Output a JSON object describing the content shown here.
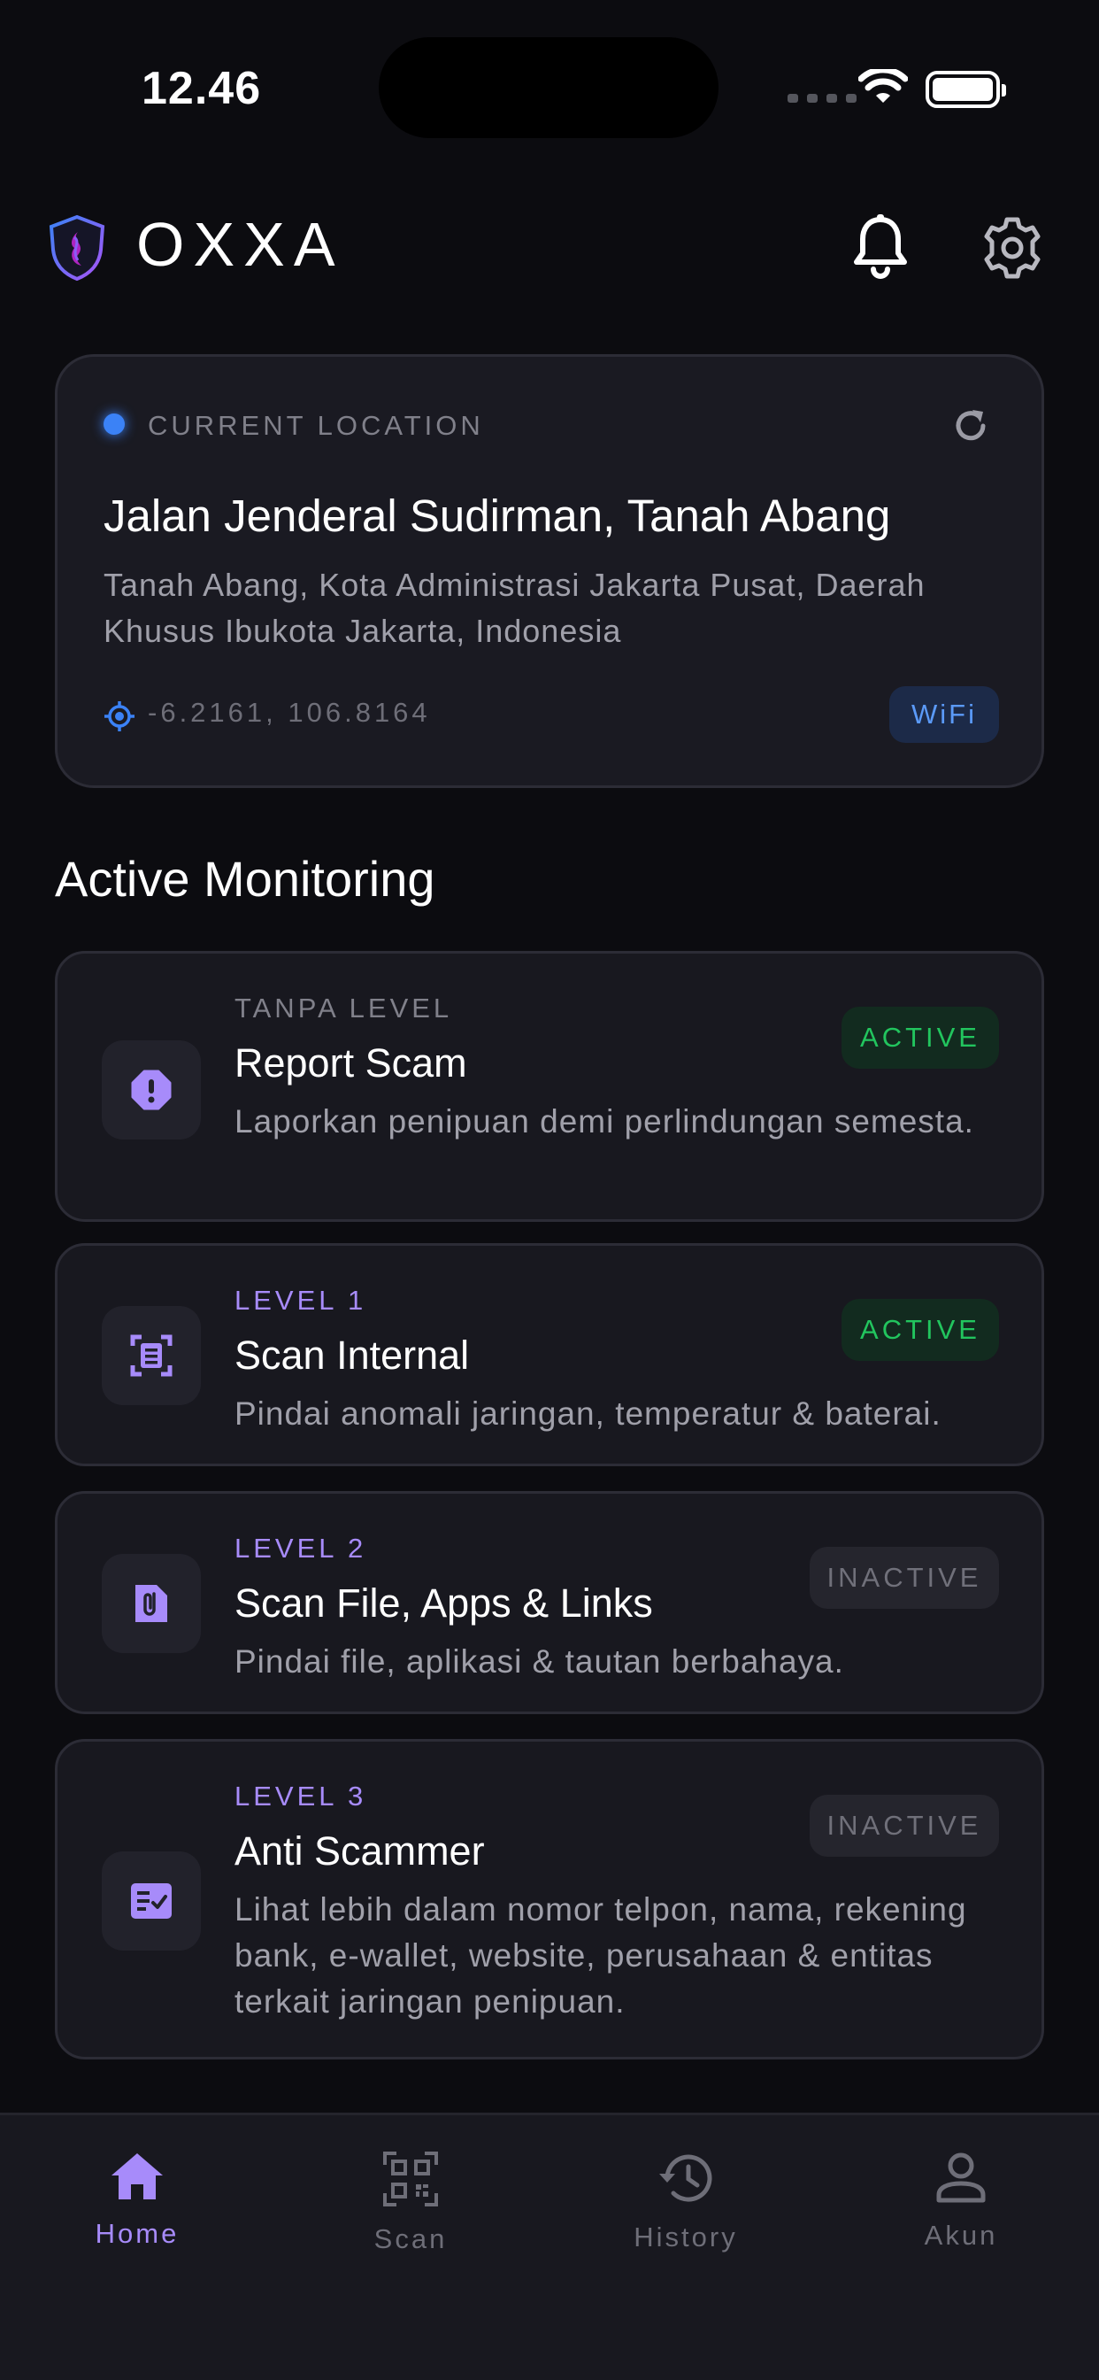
{
  "status_bar": {
    "time": "12.46"
  },
  "header": {
    "brand": "OXXA"
  },
  "location": {
    "label": "CURRENT LOCATION",
    "title": "Jalan Jenderal Sudirman, Tanah Abang",
    "subtitle": "Tanah Abang, Kota Administrasi Jakarta Pusat, Daerah Khusus Ibukota Jakarta, Indonesia",
    "coordinates": "-6.2161, 106.8164",
    "network_badge": "WiFi"
  },
  "monitoring": {
    "title": "Active Monitoring",
    "items": [
      {
        "level": "TANPA LEVEL",
        "name": "Report Scam",
        "description": "Laporkan penipuan demi perlindungan semesta.",
        "status": "ACTIVE",
        "icon": "alert-octagon-icon"
      },
      {
        "level": "LEVEL 1",
        "name": "Scan Internal",
        "description": "Pindai anomali jaringan, temperatur & baterai.",
        "status": "ACTIVE",
        "icon": "scan-document-icon"
      },
      {
        "level": "LEVEL 2",
        "name": "Scan File, Apps & Links",
        "description": "Pindai file, aplikasi & tautan berbahaya.",
        "status": "INACTIVE",
        "icon": "file-attachment-icon"
      },
      {
        "level": "LEVEL 3",
        "name": "Anti Scammer",
        "description": "Lihat lebih dalam nomor telpon, nama, rekening bank, e-wallet, website, perusahaan & entitas terkait jaringan penipuan.",
        "status": "INACTIVE",
        "icon": "checklist-icon"
      }
    ]
  },
  "nav": {
    "items": [
      {
        "label": "Home",
        "icon": "home-icon",
        "active": true
      },
      {
        "label": "Scan",
        "icon": "qr-scan-icon",
        "active": false
      },
      {
        "label": "History",
        "icon": "history-icon",
        "active": false
      },
      {
        "label": "Akun",
        "icon": "user-icon",
        "active": false
      }
    ]
  },
  "colors": {
    "background": "#0c0c10",
    "card": "#1a1a22",
    "accent_purple": "#a78bfa",
    "active_green": "#22c55e",
    "location_blue": "#3b82f6"
  }
}
